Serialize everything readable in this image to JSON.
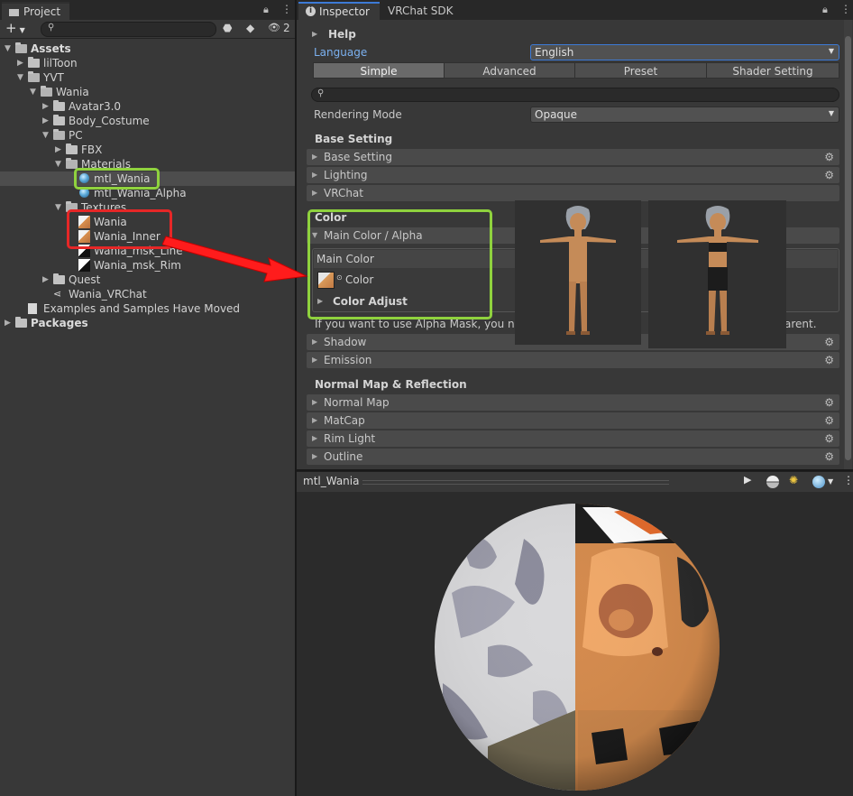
{
  "project": {
    "tab_label": "Project",
    "hidden_count": "2",
    "tree": [
      {
        "label": "Assets",
        "type": "folder",
        "expanded": true,
        "bold": true
      },
      {
        "label": "lilToon",
        "type": "folder",
        "expanded": false
      },
      {
        "label": "YVT",
        "type": "folder",
        "expanded": true
      },
      {
        "label": "Wania",
        "type": "folder",
        "expanded": true
      },
      {
        "label": "Avatar3.0",
        "type": "folder",
        "expanded": false
      },
      {
        "label": "Body_Costume",
        "type": "folder",
        "expanded": false
      },
      {
        "label": "PC",
        "type": "folder",
        "expanded": true
      },
      {
        "label": "FBX",
        "type": "folder",
        "expanded": false
      },
      {
        "label": "Materials",
        "type": "folder",
        "expanded": true
      },
      {
        "label": "mtl_Wania",
        "type": "material",
        "selected": true
      },
      {
        "label": "mtl_Wania_Alpha",
        "type": "material"
      },
      {
        "label": "Textures",
        "type": "folder",
        "expanded": true
      },
      {
        "label": "Wania",
        "type": "texture"
      },
      {
        "label": "Wania_Inner",
        "type": "texture"
      },
      {
        "label": "Wania_msk_Line",
        "type": "texture"
      },
      {
        "label": "Wania_msk_Rim",
        "type": "texture"
      },
      {
        "label": "Quest",
        "type": "folder",
        "expanded": false
      },
      {
        "label": "Wania_VRChat",
        "type": "prefab"
      },
      {
        "label": "Examples and Samples Have Moved",
        "type": "file"
      },
      {
        "label": "Packages",
        "type": "folder",
        "expanded": false,
        "bold": true
      }
    ]
  },
  "inspector": {
    "tab_label": "Inspector",
    "tab2_label": "VRChat SDK",
    "help_label": "Help",
    "language_label": "Language",
    "language_value": "English",
    "modes": [
      "Simple",
      "Advanced",
      "Preset",
      "Shader Setting"
    ],
    "rendering_mode_label": "Rendering Mode",
    "rendering_mode_value": "Opaque",
    "base_setting_title": "Base Setting",
    "base_foldouts": [
      "Base Setting",
      "Lighting",
      "VRChat"
    ],
    "color_title": "Color",
    "main_color_alpha": "Main Color / Alpha",
    "main_color_label": "Main Color",
    "color_field_label": "Color",
    "color_adjust_label": "Color Adjust",
    "alpha_note_left": "If you want to use Alpha Mask, you need",
    "alpha_note_right": "arent.",
    "color_foldouts": [
      "Shadow",
      "Emission"
    ],
    "normal_title": "Normal Map & Reflection",
    "normal_foldouts": [
      "Normal Map",
      "MatCap",
      "Rim Light",
      "Outline"
    ]
  },
  "preview": {
    "title": "mtl_Wania"
  },
  "colors": {
    "highlight_green": "#8fd23e",
    "highlight_red": "#e62727",
    "selection": "#4d4d4d",
    "accent_blue": "#7bb1f0"
  }
}
